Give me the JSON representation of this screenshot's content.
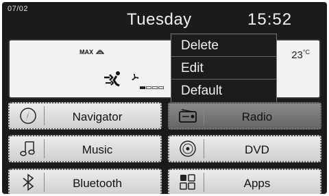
{
  "status": {
    "date": "07/02",
    "day": "Tuesday",
    "time": "15:52"
  },
  "climate": {
    "defrost_label": "MAX",
    "temperature": "23",
    "temperature_unit": "°C",
    "fan_level": 1,
    "fan_max": 4
  },
  "context_menu": {
    "items": [
      "Delete",
      "Edit",
      "Default"
    ]
  },
  "apps": [
    {
      "label": "Navigator",
      "icon": "compass-icon"
    },
    {
      "label": "Radio",
      "icon": "radio-icon"
    },
    {
      "label": "Music",
      "icon": "music-note-icon"
    },
    {
      "label": "DVD",
      "icon": "disc-icon"
    },
    {
      "label": "Bluetooth",
      "icon": "bluetooth-icon"
    },
    {
      "label": "Apps",
      "icon": "apps-grid-icon"
    }
  ]
}
